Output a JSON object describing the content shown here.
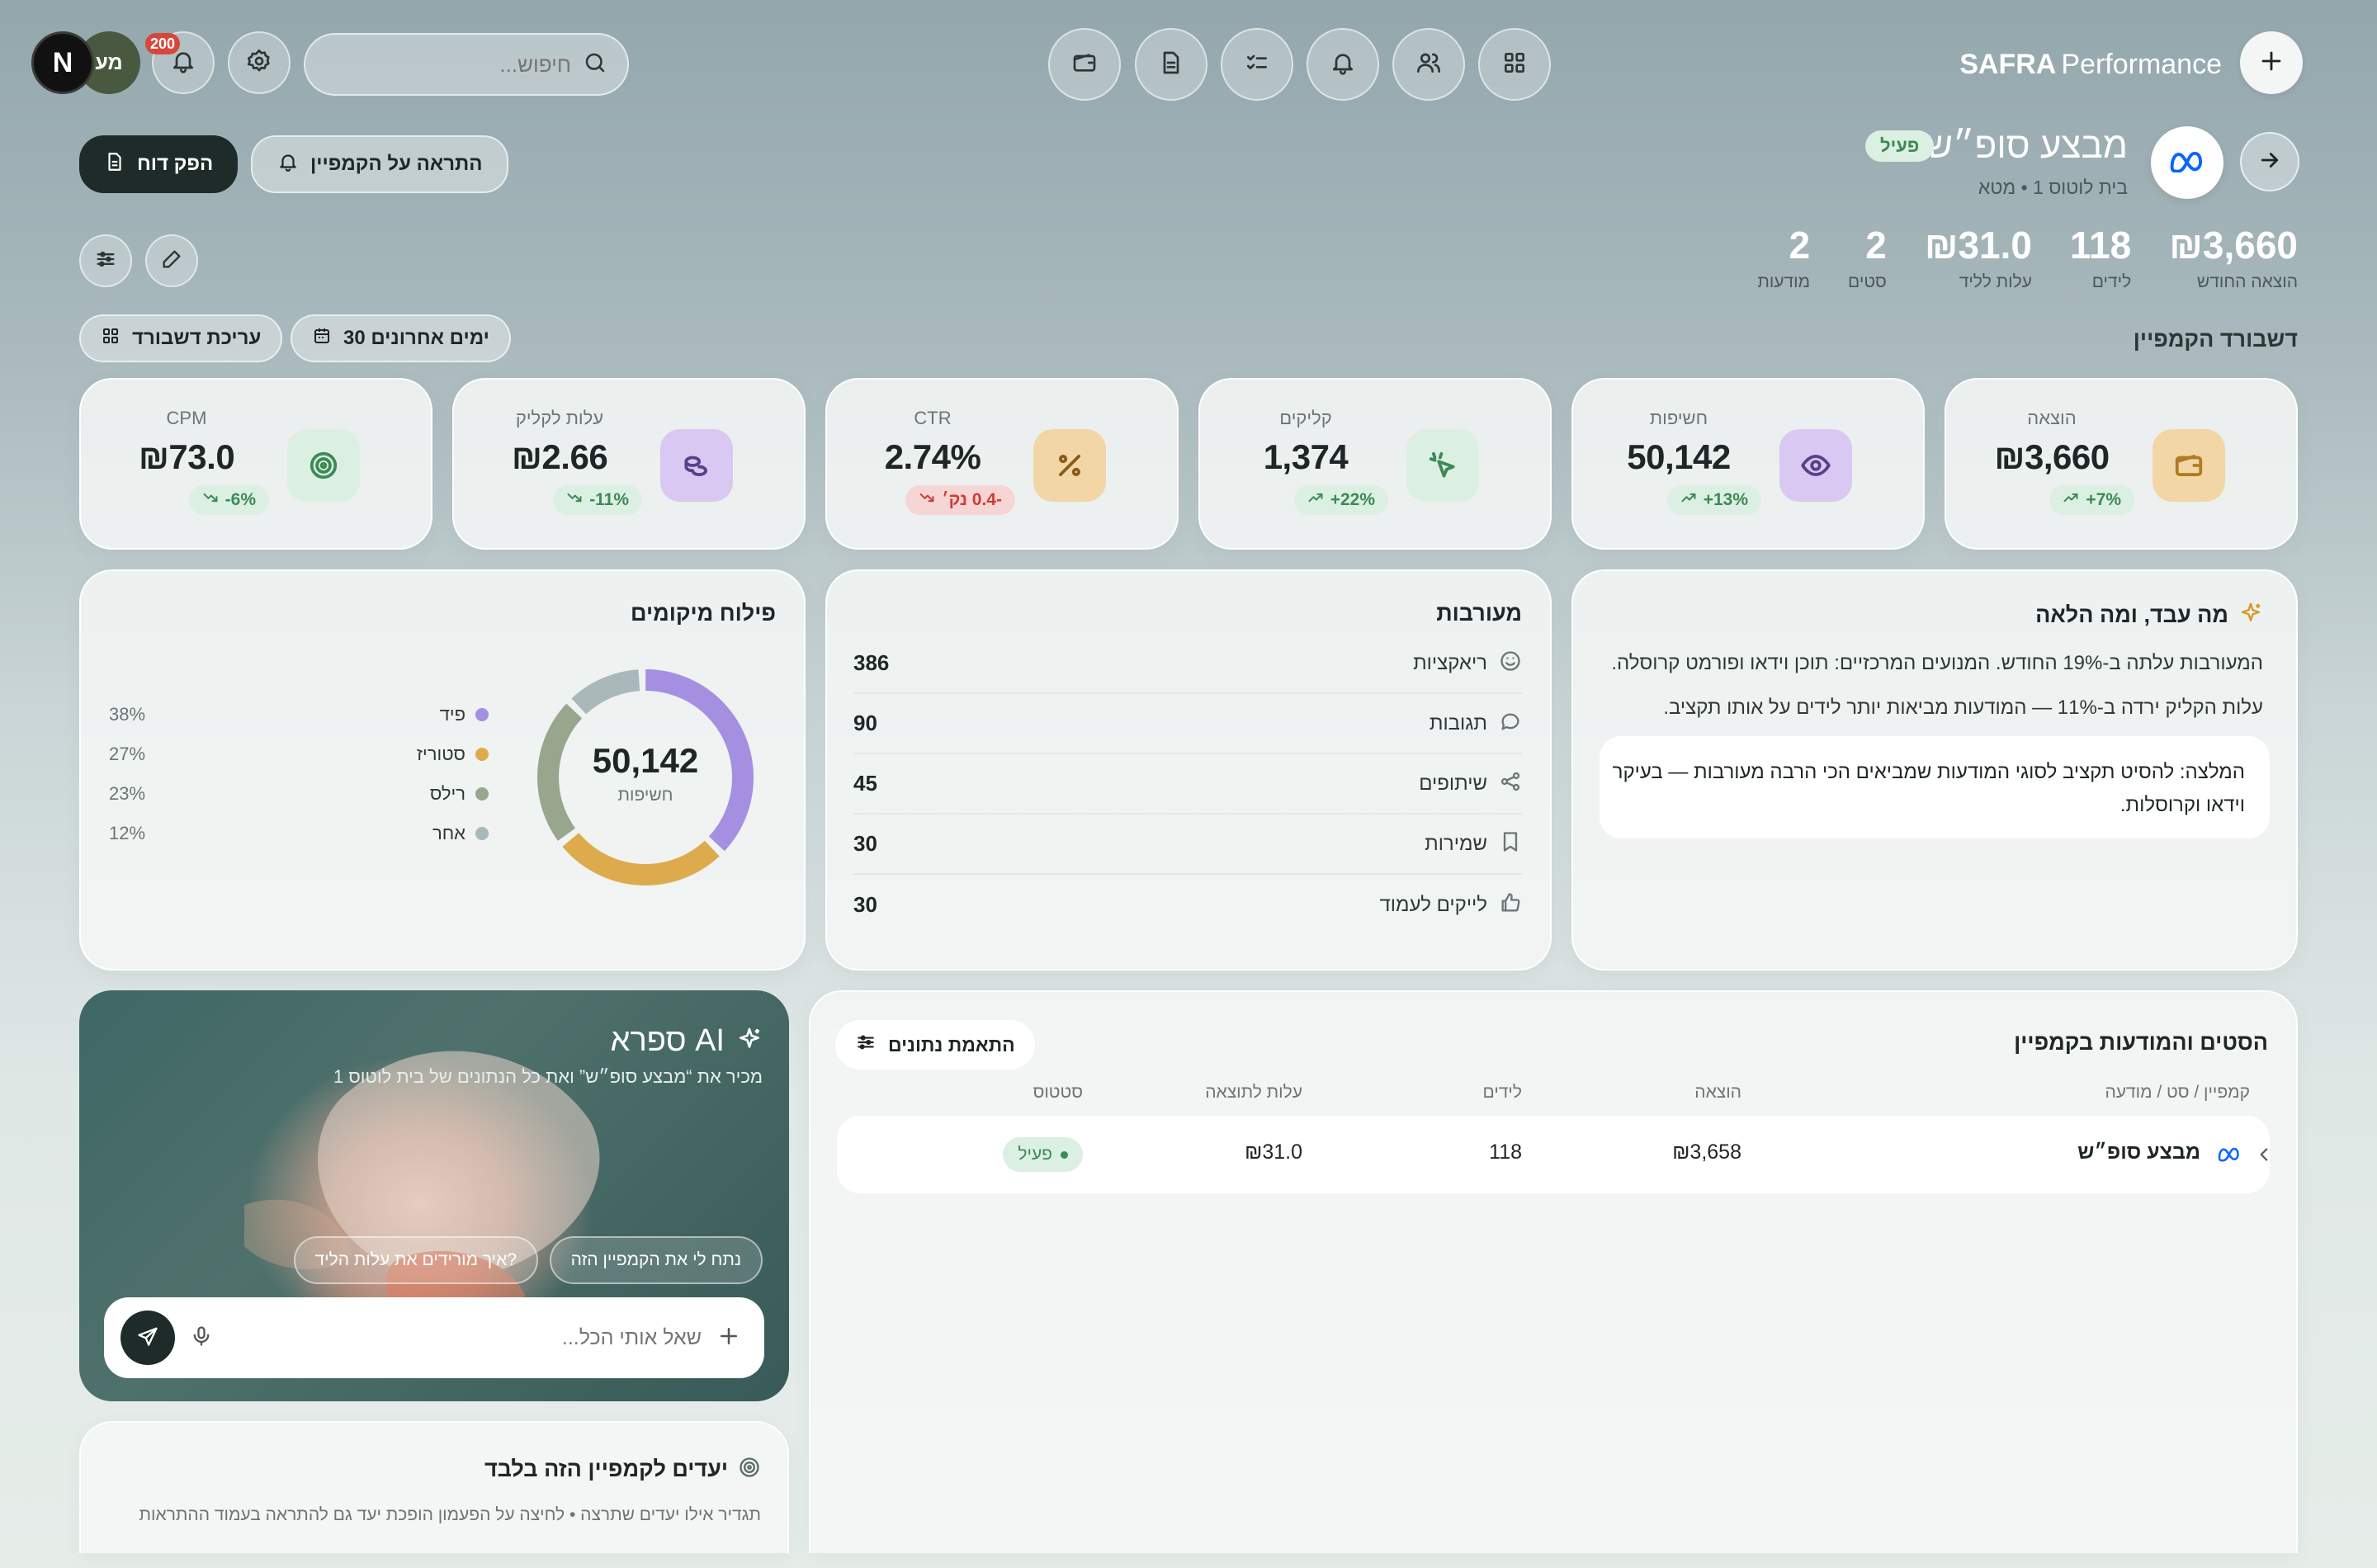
{
  "topbar": {
    "avatar_n": "N",
    "avatar_initials": "מע",
    "notif_count": "200",
    "search_placeholder": "חיפוש...",
    "brand_bold": "SAFRA",
    "brand_light": "Performance"
  },
  "actions": {
    "report_label": "הפק דוח",
    "alert_label": "התראה על הקמפיין"
  },
  "campaign": {
    "title": "מבצע סופ״ש",
    "status": "פעיל",
    "subtitle": "בית לוטוס 1 • מטא"
  },
  "summary": [
    {
      "value": "₪3,660",
      "label": "הוצאה החודש"
    },
    {
      "value": "118",
      "label": "לידים"
    },
    {
      "value": "₪31.0",
      "label": "עלות לליד"
    },
    {
      "value": "2",
      "label": "סטים"
    },
    {
      "value": "2",
      "label": "מודעות"
    }
  ],
  "dashboard": {
    "title": "דשבורד הקמפיין",
    "range_label": "30 ימים אחרונים",
    "edit_label": "עריכת דשבורד"
  },
  "kpis": [
    {
      "label": "הוצאה",
      "value": "₪3,660",
      "change": "7%+",
      "trend": "up",
      "icon": "wallet-icon",
      "tile": "#f2d6a6",
      "stroke": "#b07b25"
    },
    {
      "label": "חשיפות",
      "value": "50,142",
      "change": "13%+",
      "trend": "up",
      "icon": "eye-icon",
      "tile": "#d9c8f1",
      "stroke": "#5b3f8a"
    },
    {
      "label": "קליקים",
      "value": "1,374",
      "change": "22%+",
      "trend": "up",
      "icon": "cursor-click-icon",
      "tile": "#dcefe3",
      "stroke": "#3c8a55"
    },
    {
      "label": "CTR",
      "value": "2.74%",
      "change": "-0.4 נק׳",
      "trend": "down",
      "icon": "percent-icon",
      "tile": "#f2d6a6",
      "stroke": "#8a5a18"
    },
    {
      "label": "עלות לקליק",
      "value": "₪2.66",
      "change": "11%-",
      "trend": "good-down",
      "icon": "coins-icon",
      "tile": "#d9c8f1",
      "stroke": "#5b3f8a"
    },
    {
      "label": "CPM",
      "value": "₪73.0",
      "change": "6%-",
      "trend": "good-down",
      "icon": "target-icon",
      "tile": "#dcefe3",
      "stroke": "#3c8a55"
    }
  ],
  "insight": {
    "title": "מה עבד, ומה הלאה",
    "line1": "המעורבות עלתה ב-19% החודש. המנועים המרכזיים: תוכן וידאו ופורמט קרוסלה.",
    "line2": "עלות הקליק ירדה ב-11% — המודעות מביאות יותר לידים על אותו תקציב.",
    "rec1": "המלצה: להסיט תקציב לסוגי המודעות שמביאים הכי הרבה מעורבות — בעיקר",
    "rec2": "וידאו וקרוסלות."
  },
  "engagement": {
    "title": "מעורבות",
    "items": [
      {
        "label": "ריאקציות",
        "value": "386",
        "icon": "smile-icon"
      },
      {
        "label": "תגובות",
        "value": "90",
        "icon": "comment-icon"
      },
      {
        "label": "שיתופים",
        "value": "45",
        "icon": "share-icon"
      },
      {
        "label": "שמירות",
        "value": "30",
        "icon": "bookmark-icon"
      },
      {
        "label": "לייקים לעמוד",
        "value": "30",
        "icon": "thumbs-up-icon"
      }
    ]
  },
  "placements": {
    "title": "פילוח מיקומים",
    "total": "50,142",
    "total_label": "חשיפות",
    "items": [
      {
        "label": "פיד",
        "pct": "38%",
        "share": 0.38,
        "color": "#a48fe0"
      },
      {
        "label": "סטוריז",
        "pct": "27%",
        "share": 0.27,
        "color": "#ddab4c"
      },
      {
        "label": "רילס",
        "pct": "23%",
        "share": 0.23,
        "color": "#97a68d"
      },
      {
        "label": "אחר",
        "pct": "12%",
        "share": 0.12,
        "color": "#a9b8ba"
      }
    ]
  },
  "ai": {
    "title": "ספרא AI",
    "subtitle": "מכיר את “מבצע סופ״ש” ואת כל הנתונים של בית לוטוס 1",
    "chip1": "נתח לי את הקמפיין הזה",
    "chip2": "איך מורידים את עלות הליד?",
    "placeholder": "שאל אותי הכל..."
  },
  "goals": {
    "title": "יעדים לקמפיין הזה בלבד",
    "subtitle": "תגדיר אילו יעדים שתרצה • לחיצה על הפעמון הופכת יעד גם להתראה בעמוד ההתראות"
  },
  "table": {
    "title": "הסטים והמודעות בקמפיין",
    "match_label": "התאמת נתונים",
    "headers": {
      "name": "קמפיין / סט / מודעה",
      "spend": "הוצאה",
      "leads": "לידים",
      "cpl": "עלות לתוצאה",
      "status": "סטטוס"
    },
    "rows": [
      {
        "name": "מבצע סופ״ש",
        "spend": "₪3,658",
        "leads": "118",
        "cpl": "₪31.0",
        "status": "פעיל"
      }
    ]
  }
}
